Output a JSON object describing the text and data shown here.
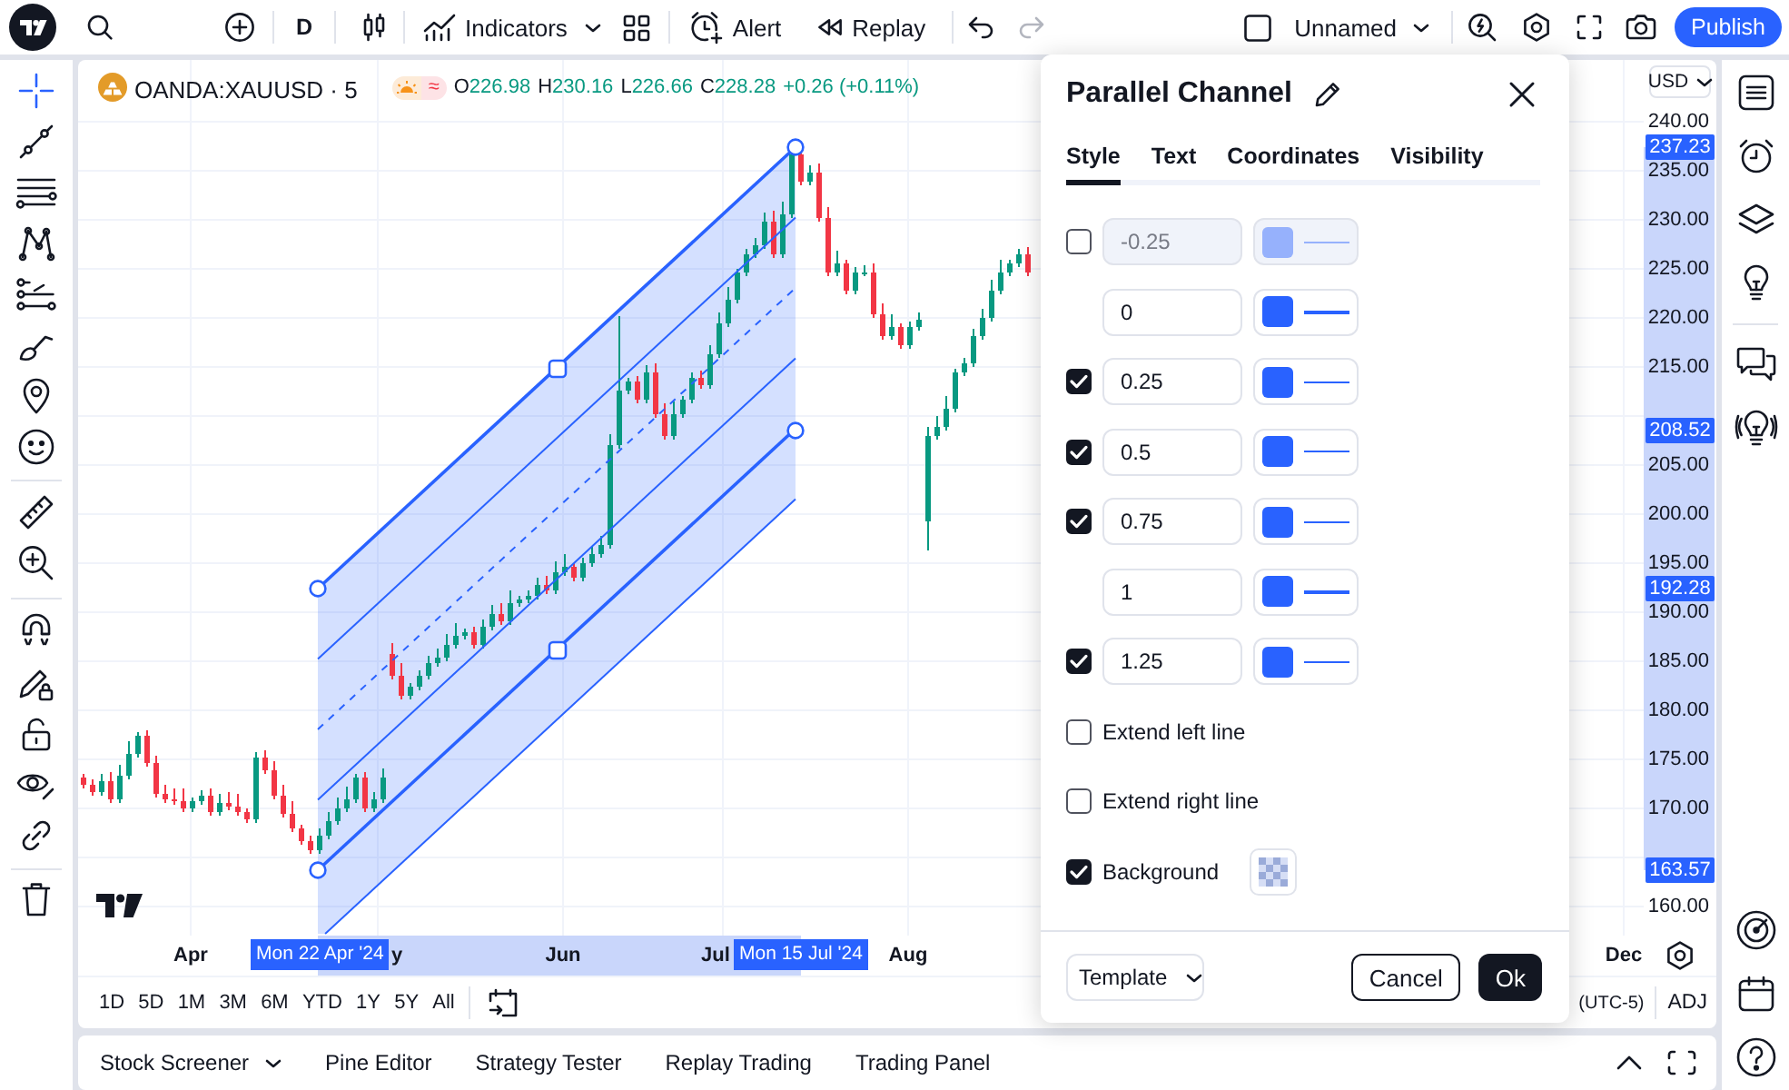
{
  "top_bar": {
    "interval": "D",
    "indicators": "Indicators",
    "alert": "Alert",
    "replay": "Replay",
    "redo_disabled": true,
    "layout_name": "Unnamed",
    "publish": "Publish"
  },
  "left_toolbar": {
    "cursor_selected": true
  },
  "chart": {
    "symbol": "OANDA:XAUUSD · 5",
    "data_badge": "≈",
    "ohlc": [
      {
        "label": "O",
        "value": "226.98"
      },
      {
        "label": "H",
        "value": "230.16"
      },
      {
        "label": "L",
        "value": "226.66"
      },
      {
        "label": "C",
        "value": "228.28"
      }
    ],
    "change": "+0.26 (+0.11%)",
    "currency": "USD",
    "price_ticks": [
      "240.00",
      "235.00",
      "230.00",
      "225.00",
      "220.00",
      "215.00",
      "205.00",
      "200.00",
      "195.00",
      "190.00",
      "185.00",
      "180.00",
      "175.00",
      "170.00",
      "160.00"
    ],
    "price_labels": [
      "237.23",
      "208.52",
      "192.28",
      "163.57"
    ],
    "time_ticks": [
      "Apr",
      "y",
      "Jun",
      "Jul",
      "Aug",
      "Dec"
    ],
    "date_labels": [
      "Mon 22 Apr '24",
      "Mon 15 Jul '24"
    ]
  },
  "range_bar": {
    "periods": [
      {
        "label": "1D",
        "selected": false
      },
      {
        "label": "5D",
        "selected": false
      },
      {
        "label": "1M",
        "selected": false
      },
      {
        "label": "3M",
        "selected": false
      },
      {
        "label": "6M",
        "selected": false
      },
      {
        "label": "YTD",
        "selected": false
      },
      {
        "label": "1Y",
        "selected": false
      },
      {
        "label": "5Y",
        "selected": false
      },
      {
        "label": "All",
        "selected": false
      }
    ],
    "timezone": "(UTC-5)",
    "adjustment": "ADJ"
  },
  "bottom_panel": {
    "tabs": [
      {
        "kind": "dropdown",
        "label": "Stock Screener",
        "selected": false
      },
      {
        "kind": "tab",
        "label": "Pine Editor",
        "selected": false
      },
      {
        "kind": "tab",
        "label": "Strategy Tester",
        "selected": false
      },
      {
        "kind": "tab",
        "label": "Replay Trading",
        "selected": false
      },
      {
        "kind": "tab",
        "label": "Trading Panel",
        "selected": false
      }
    ]
  },
  "dialog": {
    "title": "Parallel Channel",
    "tabs": [
      {
        "label": "Style",
        "selected": true
      },
      {
        "label": "Text",
        "selected": false
      },
      {
        "label": "Coordinates",
        "selected": false
      },
      {
        "label": "Visibility",
        "selected": false
      }
    ],
    "levels": [
      {
        "kind": "optional",
        "checked": false,
        "value": "-0.25",
        "thick": false
      },
      {
        "kind": "fixed",
        "value": "0",
        "thick": true
      },
      {
        "kind": "optional",
        "checked": true,
        "value": "0.25",
        "thick": false
      },
      {
        "kind": "optional",
        "checked": true,
        "value": "0.5",
        "thick": false
      },
      {
        "kind": "optional",
        "checked": true,
        "value": "0.75",
        "thick": false
      },
      {
        "kind": "fixed",
        "value": "1",
        "thick": true
      },
      {
        "kind": "optional",
        "checked": true,
        "value": "1.25",
        "thick": false
      }
    ],
    "options": [
      {
        "kind": "checkbox",
        "label": "Extend left line",
        "checked": false
      },
      {
        "kind": "checkbox",
        "label": "Extend right line",
        "checked": false
      },
      {
        "kind": "fill",
        "label": "Background",
        "checked": true
      }
    ],
    "template": "Template",
    "buttons": [
      {
        "kind": "secondary",
        "label": "Cancel"
      },
      {
        "kind": "primary",
        "label": "Ok"
      }
    ]
  }
}
